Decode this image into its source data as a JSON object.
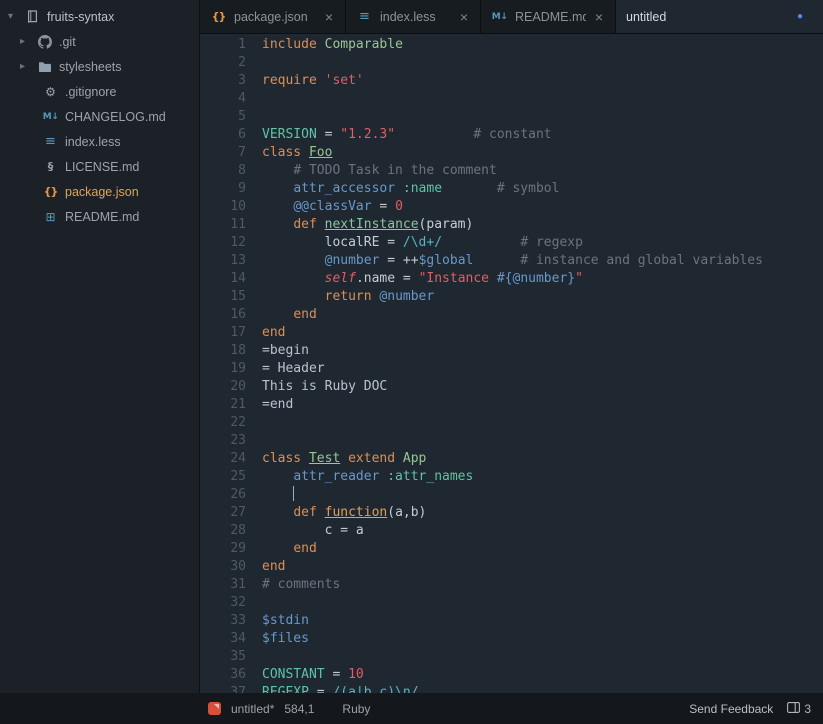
{
  "ui": {
    "close_glyph": "×",
    "modified_dot": "●",
    "disclosure_open": "▾",
    "disclosure_closed": "▸"
  },
  "sidebar": {
    "root_label": "fruits-syntax",
    "items": [
      {
        "label": ".git",
        "icon": "github",
        "kind": "folder",
        "selected": false
      },
      {
        "label": "stylesheets",
        "icon": "folder",
        "kind": "folder",
        "selected": false
      },
      {
        "label": ".gitignore",
        "icon": "gear",
        "kind": "file",
        "selected": false
      },
      {
        "label": "CHANGELOG.md",
        "icon": "markdown",
        "kind": "file",
        "selected": false
      },
      {
        "label": "index.less",
        "icon": "less",
        "kind": "file",
        "selected": false
      },
      {
        "label": "LICENSE.md",
        "icon": "license",
        "kind": "file",
        "selected": false
      },
      {
        "label": "package.json",
        "icon": "json",
        "kind": "file",
        "selected": true
      },
      {
        "label": "README.md",
        "icon": "book",
        "kind": "file",
        "selected": false
      }
    ]
  },
  "tabs": [
    {
      "label": "package.json",
      "icon": "json",
      "closable": true,
      "active": false,
      "modified": false
    },
    {
      "label": "index.less",
      "icon": "less",
      "closable": true,
      "active": false,
      "modified": false
    },
    {
      "label": "README.md",
      "icon": "markdown",
      "closable": true,
      "active": false,
      "modified": false
    },
    {
      "label": "untitled",
      "icon": "none",
      "closable": false,
      "active": true,
      "modified": true
    }
  ],
  "editor": {
    "language": "Ruby",
    "lines": [
      [
        [
          "kw",
          "include"
        ],
        [
          "t",
          " "
        ],
        [
          "cls",
          "Comparable"
        ]
      ],
      [],
      [
        [
          "kw",
          "require"
        ],
        [
          "t",
          " "
        ],
        [
          "str",
          "'set'"
        ]
      ],
      [],
      [],
      [
        [
          "const",
          "VERSION"
        ],
        [
          "t",
          " = "
        ],
        [
          "str",
          "\"1.2.3\""
        ],
        [
          "t",
          "          "
        ],
        [
          "com",
          "# constant"
        ]
      ],
      [
        [
          "kw",
          "class"
        ],
        [
          "t",
          " "
        ],
        [
          "clsu",
          "Foo"
        ]
      ],
      [
        [
          "t",
          "    "
        ],
        [
          "com",
          "# TODO Task in the comment"
        ]
      ],
      [
        [
          "t",
          "    "
        ],
        [
          "fn",
          "attr_accessor"
        ],
        [
          "t",
          " "
        ],
        [
          "sym",
          ":name"
        ],
        [
          "t",
          "       "
        ],
        [
          "com",
          "# symbol"
        ]
      ],
      [
        [
          "t",
          "    "
        ],
        [
          "var",
          "@@classVar"
        ],
        [
          "t",
          " = "
        ],
        [
          "num",
          "0"
        ]
      ],
      [
        [
          "t",
          "    "
        ],
        [
          "kw",
          "def"
        ],
        [
          "t",
          " "
        ],
        [
          "defg",
          "nextInstance"
        ],
        [
          "t",
          "(param)"
        ]
      ],
      [
        [
          "t",
          "        localRE = "
        ],
        [
          "rx",
          "/\\d+/"
        ],
        [
          "t",
          "          "
        ],
        [
          "com",
          "# regexp"
        ]
      ],
      [
        [
          "t",
          "        "
        ],
        [
          "var",
          "@number"
        ],
        [
          "t",
          " = ++"
        ],
        [
          "var",
          "$global"
        ],
        [
          "t",
          "      "
        ],
        [
          "com",
          "# instance and global variables"
        ]
      ],
      [
        [
          "t",
          "        "
        ],
        [
          "slf",
          "self"
        ],
        [
          "t",
          ".name = "
        ],
        [
          "str",
          "\"Instance "
        ],
        [
          "var",
          "#{@number}"
        ],
        [
          "str",
          "\""
        ]
      ],
      [
        [
          "t",
          "        "
        ],
        [
          "kw",
          "return"
        ],
        [
          "t",
          " "
        ],
        [
          "var",
          "@number"
        ]
      ],
      [
        [
          "t",
          "    "
        ],
        [
          "kw",
          "end"
        ]
      ],
      [
        [
          "kw",
          "end"
        ]
      ],
      [
        [
          "doc",
          "=begin"
        ]
      ],
      [
        [
          "doc",
          "= Header"
        ]
      ],
      [
        [
          "doc",
          "This is Ruby DOC"
        ]
      ],
      [
        [
          "doc",
          "=end"
        ]
      ],
      [],
      [],
      [
        [
          "kw",
          "class"
        ],
        [
          "t",
          " "
        ],
        [
          "clsu",
          "Test"
        ],
        [
          "t",
          " "
        ],
        [
          "kw",
          "extend"
        ],
        [
          "t",
          " "
        ],
        [
          "cls",
          "App"
        ]
      ],
      [
        [
          "t",
          "    "
        ],
        [
          "fn",
          "attr_reader"
        ],
        [
          "t",
          " "
        ],
        [
          "sym",
          ":attr_names"
        ]
      ],
      [
        [
          "t",
          "    "
        ],
        [
          "cur",
          ""
        ]
      ],
      [
        [
          "t",
          "    "
        ],
        [
          "kw",
          "def"
        ],
        [
          "t",
          " "
        ],
        [
          "defo",
          "function"
        ],
        [
          "t",
          "(a,b)"
        ]
      ],
      [
        [
          "t",
          "        c = a"
        ]
      ],
      [
        [
          "t",
          "    "
        ],
        [
          "kw",
          "end"
        ]
      ],
      [
        [
          "kw",
          "end"
        ]
      ],
      [
        [
          "com",
          "# comments"
        ]
      ],
      [],
      [
        [
          "var",
          "$stdin"
        ]
      ],
      [
        [
          "var",
          "$files"
        ]
      ],
      [],
      [
        [
          "const",
          "CONSTANT"
        ],
        [
          "t",
          " = "
        ],
        [
          "num",
          "10"
        ]
      ],
      [
        [
          "const",
          "REGEXP"
        ],
        [
          "t",
          " = "
        ],
        [
          "rx",
          "/(a|b c)\\n/"
        ]
      ]
    ]
  },
  "status_bar": {
    "file": "untitled*",
    "position": "584,1",
    "grammar": "Ruby",
    "feedback": "Send Feedback",
    "github_count": "3"
  },
  "colors": {
    "accent_blue": "#568af2",
    "selected_file_orange": "#e0a458",
    "editor_bg": "#1f2730",
    "sidebar_bg": "#1c2127",
    "tabbar_bg": "#0f1317",
    "statusbar_bg": "#14171b",
    "syntax": {
      "keyword": "#dd8f55",
      "class_name": "#99c794",
      "constant": "#5fc4a6",
      "string": "#e25d66",
      "number": "#e25d66",
      "comment": "#6b737e",
      "variable": "#6699cc",
      "function": "#6699cc",
      "symbol": "#5fc4a6",
      "regexp": "#56b6c2",
      "doc": "#b9c3ce",
      "default": "#c3ccd6",
      "self": "#e25d66",
      "def_green": "#8ac6a0",
      "def_orange": "#e0a05a"
    }
  }
}
